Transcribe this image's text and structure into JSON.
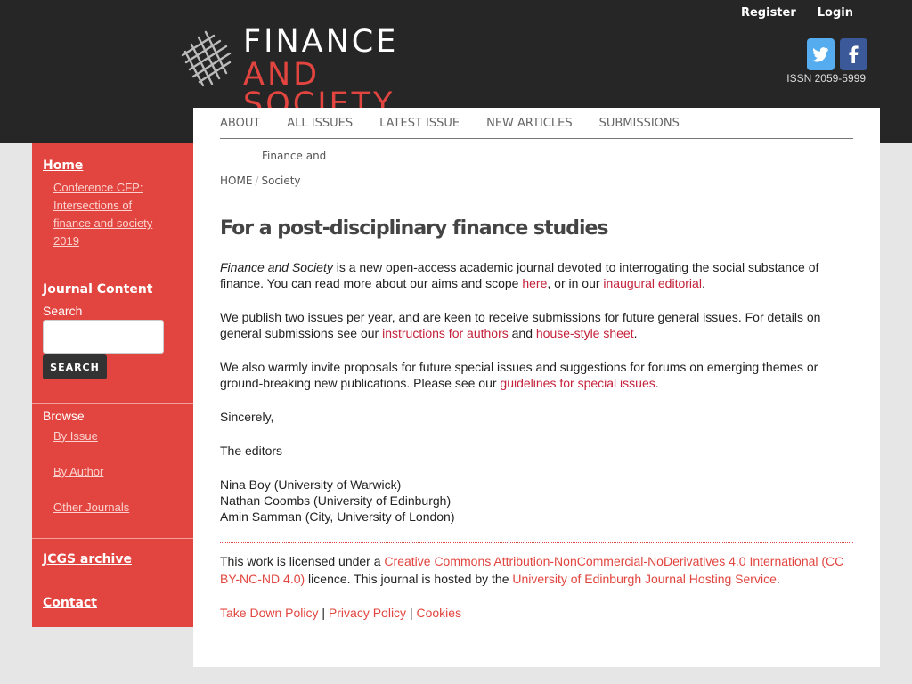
{
  "header": {
    "top_links": [
      "Register",
      "Login"
    ],
    "logo": {
      "line1": "FINANCE",
      "line2": "AND",
      "line3": "SOCIETY"
    },
    "social": [
      "twitter-icon",
      "facebook-icon"
    ],
    "issn": "ISSN 2059-5999"
  },
  "colors": {
    "accent": "#e2453f",
    "link": "#c4213a",
    "header_bg": "#262626",
    "page_bg": "#e6e6e6"
  },
  "nav": [
    "ABOUT",
    "ALL ISSUES",
    "LATEST ISSUE",
    "NEW ARTICLES",
    "SUBMISSIONS"
  ],
  "brand_crumb": "Finance and",
  "breadcrumb": {
    "home": "HOME",
    "sep": "/",
    "current": "Society"
  },
  "sidebar": {
    "home": "Home",
    "home_sub": "Conference CFP: Intersections of finance and society 2019",
    "journal_content": "Journal Content",
    "search_label": "Search",
    "search_button": "SEARCH",
    "browse": "Browse",
    "browse_items": [
      "By Issue",
      "By Author",
      "Other Journals"
    ],
    "jcgs": "JCGS archive",
    "contact": "Contact"
  },
  "page": {
    "title": "For a post-disciplinary finance studies",
    "p1": {
      "em": "Finance and Society",
      "t1": " is a new open-access academic journal devoted to interrogating the social substance of finance. You can read more about our aims and scope ",
      "link1": "here",
      "t2": ", or in our ",
      "link2": "inaugural editorial",
      "t3": "."
    },
    "p2": {
      "t1": "We publish two issues per year, and are keen to receive submissions for future general issues. For details on general submissions see our ",
      "link1": "instructions for authors",
      "t2": " and ",
      "link2": "house-style sheet",
      "t3": "."
    },
    "p3": {
      "t1": "We also warmly invite proposals for future special issues and suggestions for forums on emerging themes or ground-breaking new publications. Please see our ",
      "link1": "guidelines for special issues",
      "t2": "."
    },
    "sincerely": "Sincerely,",
    "editors": "The editors",
    "names": [
      "Nina Boy (University of Warwick)",
      "Nathan Coombs (University of Edinburgh)",
      "Amin Samman (City, University of London)"
    ]
  },
  "footer": {
    "t1": "This work is licensed under a ",
    "license": "Creative Commons Attribution-NonCommercial-NoDerivatives 4.0 International (CC BY-NC-ND 4.0)",
    "t2": " licence. This journal is hosted by the ",
    "host": "University of Edinburgh Journal Hosting Service",
    "t3": ".",
    "links": [
      "Take Down Policy",
      "Privacy Policy",
      "Cookies"
    ],
    "sep": " | "
  }
}
